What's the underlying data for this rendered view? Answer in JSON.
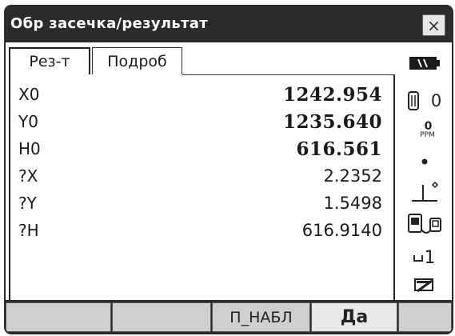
{
  "window": {
    "title": "Обр засечка/результат",
    "close_symbol": "×"
  },
  "tabs": [
    {
      "label": "Рез-т",
      "active": true
    },
    {
      "label": "Подроб",
      "active": false
    }
  ],
  "results": [
    {
      "label": "X0",
      "value": "1242.954"
    },
    {
      "label": "Y0",
      "value": "1235.640"
    },
    {
      "label": "H0",
      "value": "616.561"
    },
    {
      "label": "?X",
      "value": "2.2352"
    },
    {
      "label": "?Y",
      "value": "1.5498"
    },
    {
      "label": "?H",
      "value": "616.9140"
    }
  ],
  "status": {
    "battery_icon": "battery-icon",
    "prism_constant": "0",
    "ppm_value": "0",
    "ppm_unit": "PPM",
    "target_icon": "target-dot-icon",
    "tilt_icon": "tilt-compensation-icon",
    "instrument_icon": "instrument-icon",
    "face_indicator": "1",
    "input_mode_icon": "input-mode-icon"
  },
  "softkeys": [
    {
      "label": ""
    },
    {
      "label": ""
    },
    {
      "label": "П_НАБЛ"
    },
    {
      "label": "Да"
    },
    {
      "label": ""
    }
  ]
}
